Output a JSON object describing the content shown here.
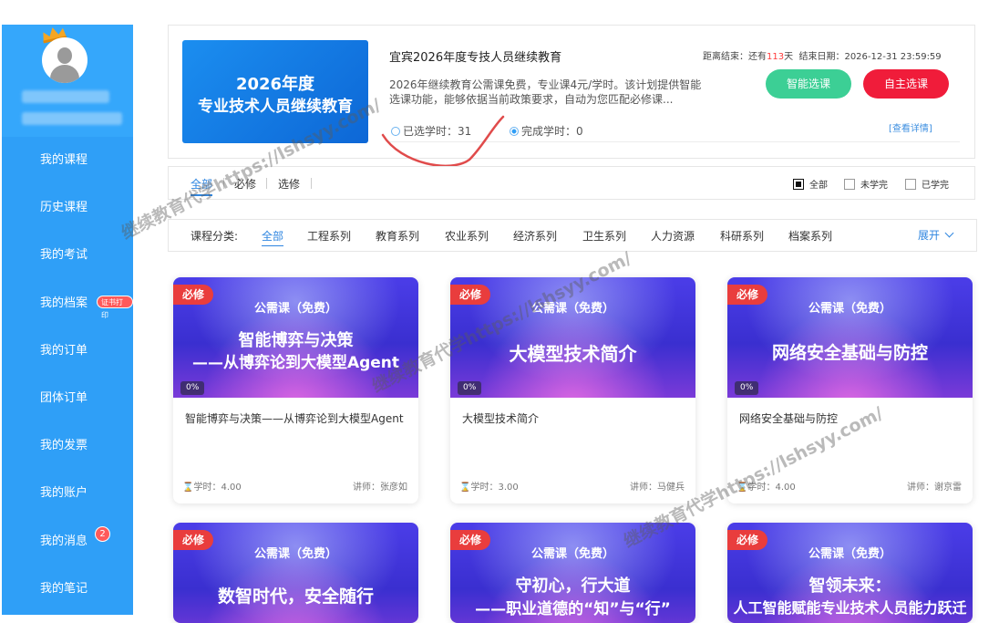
{
  "sidebar": {
    "items": [
      {
        "label": "我的课程"
      },
      {
        "label": "历史课程"
      },
      {
        "label": "我的考试"
      },
      {
        "label": "我的档案",
        "badge": "证书打印"
      },
      {
        "label": "我的订单"
      },
      {
        "label": "团体订单"
      },
      {
        "label": "我的发票"
      },
      {
        "label": "我的账户"
      },
      {
        "label": "我的消息",
        "count": "2"
      },
      {
        "label": "我的笔记"
      }
    ]
  },
  "plan": {
    "banner_line1": "2026年度",
    "banner_line2": "专业技术人员继续教育",
    "title": "宜宾2026年度专技人员继续教育",
    "deadline_prefix": "距离结束：还有",
    "deadline_days": "113",
    "deadline_suffix": "天",
    "end_date": "结束日期：2026-12-31 23:59:59",
    "description": "2026年继续教育公需课免费，专业课4元/学时。该计划提供智能选课功能，能够依据当前政策要求，自动为您匹配必修课...",
    "smart_select": "智能选课",
    "self_select": "自主选课",
    "selected_hours": "已选学时：31",
    "completed_hours": "完成学时：0",
    "detail_link": "[查看详情]"
  },
  "filter": {
    "tabs": [
      "全部",
      "必修",
      "选修"
    ],
    "checks": [
      "全部",
      "未学完",
      "已学完"
    ]
  },
  "categories": {
    "label": "课程分类:",
    "items": [
      "全部",
      "工程系列",
      "教育系列",
      "农业系列",
      "经济系列",
      "卫生系列",
      "人力资源",
      "科研系列",
      "档案系列"
    ],
    "expand": "展开"
  },
  "courses": [
    {
      "tag": "必修",
      "sub": "公需课（免费）",
      "img_t1": "智能博弈与决策",
      "img_t2": "——从博弈论到大模型Agent",
      "progress": "0%",
      "title": "智能博弈与决策——从博弈论到大模型Agent",
      "hours": "学时：4.00",
      "teacher": "讲师：张彦如"
    },
    {
      "tag": "必修",
      "sub": "公需课（免费）",
      "img_t1": "大模型技术简介",
      "img_t2": "",
      "progress": "0%",
      "title": "大模型技术简介",
      "hours": "学时：3.00",
      "teacher": "讲师：马健兵"
    },
    {
      "tag": "必修",
      "sub": "公需课（免费）",
      "img_t1": "网络安全基础与防控",
      "img_t2": "",
      "progress": "0%",
      "title": "网络安全基础与防控",
      "hours": "学时：4.00",
      "teacher": "讲师：谢京雷"
    },
    {
      "tag": "必修",
      "sub": "公需课（免费）",
      "img_t1": "数智时代，安全随行",
      "img_t2": ""
    },
    {
      "tag": "必修",
      "sub": "公需课（免费）",
      "img_t1": "守初心，行大道",
      "img_t2": "——职业道德的“知”与“行”"
    },
    {
      "tag": "必修",
      "sub": "公需课（免费）",
      "img_t1": "智领未来：",
      "img_t2": "人工智能赋能专业技术人员能力跃迁"
    }
  ],
  "watermark": "继续教育代学https://lshsyy.com/"
}
